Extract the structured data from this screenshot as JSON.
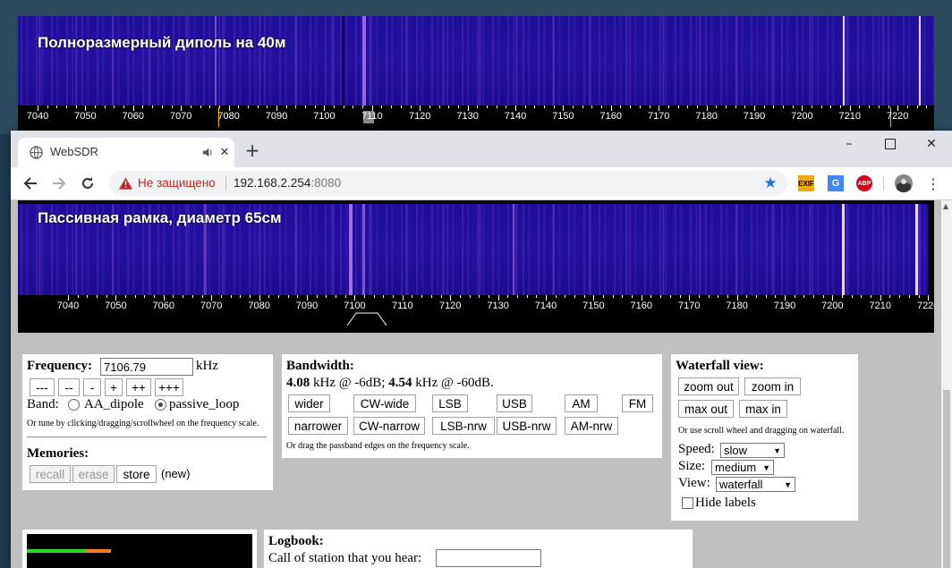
{
  "background_window": {
    "waterfall_title": "Полноразмерный диполь на 40м",
    "scale_ticks": [
      "7040",
      "7050",
      "7060",
      "7070",
      "7080",
      "7090",
      "7100",
      "7110",
      "7120",
      "7130",
      "7140",
      "7150",
      "7160",
      "7170",
      "7180",
      "7190",
      "7200",
      "7210",
      "7220"
    ]
  },
  "browser": {
    "tab_title": "WebSDR",
    "security_label": "Не защищено",
    "url_host": "192.168.2.254",
    "url_port": ":8080",
    "window_controls": [
      "minimize",
      "maximize",
      "close"
    ],
    "extensions": [
      "EXIF",
      "translate",
      "ABP"
    ]
  },
  "waterfall": {
    "title": "Пассивная рамка, диаметр 65см",
    "scale_ticks": [
      "7040",
      "7050",
      "7060",
      "7070",
      "7080",
      "7090",
      "7100",
      "7110",
      "7120",
      "7130",
      "7140",
      "7150",
      "7160",
      "7170",
      "7180",
      "7190",
      "7200",
      "7210",
      "7220"
    ]
  },
  "frequency_panel": {
    "label": "Frequency:",
    "value": "7106.79",
    "unit": "kHz",
    "step_buttons": [
      "---",
      "--",
      "-",
      "+",
      "++",
      "+++"
    ],
    "band_label": "Band:",
    "band_options": [
      "AA_dipole",
      "passive_loop"
    ],
    "band_selected": "passive_loop",
    "hint": "Or tune by clicking/dragging/scrollwheel on the frequency scale.",
    "memories_label": "Memories:",
    "memory_buttons": [
      "recall",
      "erase",
      "store"
    ],
    "memory_status": "(new)"
  },
  "bandwidth_panel": {
    "label": "Bandwidth:",
    "bw6": "4.08",
    "bw6_text": " kHz @ -6dB; ",
    "bw60": "4.54",
    "bw60_text": " kHz @ -60dB.",
    "mode_row1": [
      "wider",
      "CW-wide",
      "LSB",
      "USB",
      "AM",
      "FM"
    ],
    "mode_row2": [
      "narrower",
      "CW-narrow",
      "LSB-nrw",
      "USB-nrw",
      "AM-nrw"
    ],
    "hint": "Or drag the passband edges on the frequency scale."
  },
  "waterfall_panel": {
    "label": "Waterfall view:",
    "buttons": [
      "zoom out",
      "zoom in",
      "max out",
      "max in"
    ],
    "hint": "Or use scroll wheel and dragging on waterfall.",
    "speed_label": "Speed:",
    "speed_value": "slow",
    "size_label": "Size:",
    "size_value": "medium",
    "view_label": "View:",
    "view_value": "waterfall",
    "hide_labels": "Hide labels"
  },
  "logbook_panel": {
    "label": "Logbook:",
    "call_label": "Call of station that you hear:"
  },
  "colors": {
    "waterfall_bg": "#1e0e9a",
    "signal": "#c47bff",
    "passband": "#f0c000",
    "smeter_green": "#22dd22",
    "smeter_orange": "#ff7a1a"
  }
}
